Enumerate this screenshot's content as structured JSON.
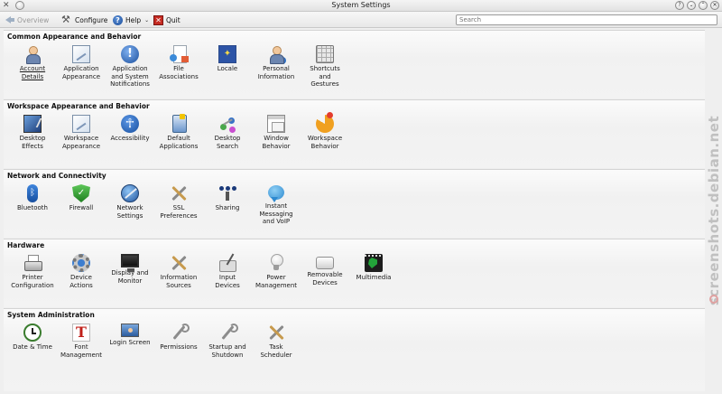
{
  "window": {
    "title": "System Settings"
  },
  "toolbar": {
    "overview": "Overview",
    "configure": "Configure",
    "help": "Help",
    "quit": "Quit",
    "search_placeholder": "Search"
  },
  "watermark": {
    "text": "screenshots.debian.net"
  },
  "colors": {
    "window_bg": "#efefef",
    "quit_red": "#c62b22",
    "help_blue": "#1d4f9c"
  },
  "categories": [
    {
      "title": "Common Appearance and Behavior",
      "items": [
        {
          "label": "Account\nDetails",
          "icon": "account-details-icon"
        },
        {
          "label": "Application\nAppearance",
          "icon": "application-appearance-icon"
        },
        {
          "label": "Application\nand System\nNotifications",
          "icon": "notifications-icon"
        },
        {
          "label": "File\nAssociations",
          "icon": "file-associations-icon"
        },
        {
          "label": "Locale",
          "icon": "locale-icon"
        },
        {
          "label": "Personal\nInformation",
          "icon": "personal-information-icon"
        },
        {
          "label": "Shortcuts\nand\nGestures",
          "icon": "keyboard-shortcuts-icon"
        }
      ]
    },
    {
      "title": "Workspace Appearance and Behavior",
      "items": [
        {
          "label": "Desktop\nEffects",
          "icon": "desktop-effects-icon"
        },
        {
          "label": "Workspace\nAppearance",
          "icon": "workspace-appearance-icon"
        },
        {
          "label": "Accessibility",
          "icon": "accessibility-icon"
        },
        {
          "label": "Default\nApplications",
          "icon": "default-applications-icon"
        },
        {
          "label": "Desktop\nSearch",
          "icon": "desktop-search-icon"
        },
        {
          "label": "Window\nBehavior",
          "icon": "window-behavior-icon"
        },
        {
          "label": "Workspace\nBehavior",
          "icon": "workspace-behavior-icon"
        }
      ]
    },
    {
      "title": "Network and Connectivity",
      "items": [
        {
          "label": "Bluetooth",
          "icon": "bluetooth-icon"
        },
        {
          "label": "Firewall",
          "icon": "firewall-shield-icon"
        },
        {
          "label": "Network\nSettings",
          "icon": "network-globe-icon"
        },
        {
          "label": "SSL\nPreferences",
          "icon": "ssl-tools-icon"
        },
        {
          "label": "Sharing",
          "icon": "sharing-icon"
        },
        {
          "label": "Instant\nMessaging\nand VoIP",
          "icon": "chat-bubble-icon"
        }
      ]
    },
    {
      "title": "Hardware",
      "items": [
        {
          "label": "Printer\nConfiguration",
          "icon": "printer-icon"
        },
        {
          "label": "Device\nActions",
          "icon": "device-actions-gear-icon"
        },
        {
          "label": "Display and\nMonitor",
          "icon": "monitor-icon"
        },
        {
          "label": "Information\nSources",
          "icon": "information-tools-icon"
        },
        {
          "label": "Input\nDevices",
          "icon": "input-stylus-icon"
        },
        {
          "label": "Power\nManagement",
          "icon": "lightbulb-icon"
        },
        {
          "label": "Removable\nDevices",
          "icon": "drive-icon"
        },
        {
          "label": "Multimedia",
          "icon": "multimedia-film-icon"
        }
      ]
    },
    {
      "title": "System Administration",
      "items": [
        {
          "label": "Date & Time",
          "icon": "clock-icon"
        },
        {
          "label": "Font\nManagement",
          "icon": "font-icon"
        },
        {
          "label": "Login Screen",
          "icon": "login-screen-icon"
        },
        {
          "label": "Permissions",
          "icon": "permissions-wrench-icon"
        },
        {
          "label": "Startup and\nShutdown",
          "icon": "startup-wrench-icon"
        },
        {
          "label": "Task\nScheduler",
          "icon": "task-scheduler-tools-icon"
        }
      ]
    }
  ]
}
